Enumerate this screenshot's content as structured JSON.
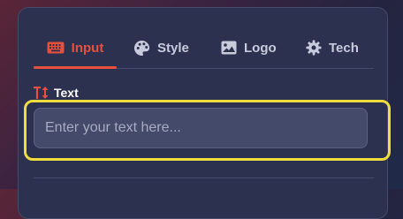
{
  "tabs": [
    {
      "label": "Input",
      "icon": "keyboard-icon",
      "active": true
    },
    {
      "label": "Style",
      "icon": "palette-icon",
      "active": false
    },
    {
      "label": "Logo",
      "icon": "image-icon",
      "active": false
    },
    {
      "label": "Tech",
      "icon": "gear-icon",
      "active": false
    }
  ],
  "text_field": {
    "label": "Text",
    "icon": "text-height-icon",
    "placeholder": "Enter your text here...",
    "value": ""
  },
  "colors": {
    "accent": "#e8503e",
    "highlight": "#f0dc3c"
  }
}
